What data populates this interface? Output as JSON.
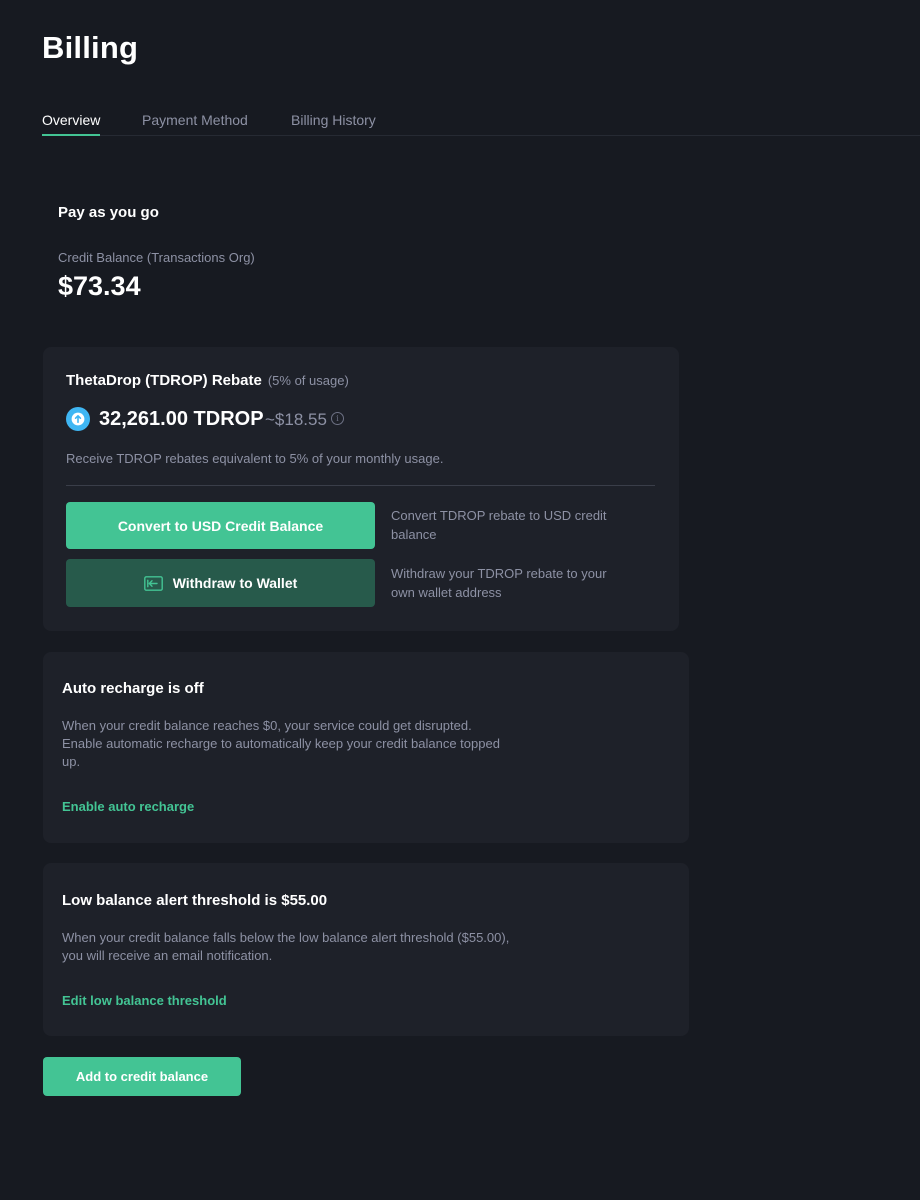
{
  "page": {
    "title": "Billing"
  },
  "tabs": [
    {
      "label": "Overview",
      "active": true
    },
    {
      "label": "Payment Method",
      "active": false
    },
    {
      "label": "Billing History",
      "active": false
    }
  ],
  "plan": {
    "title": "Pay as you go",
    "credit_label": "Credit Balance (Transactions Org)",
    "credit_amount": "$73.34"
  },
  "rebate": {
    "title": "ThetaDrop (TDROP) Rebate",
    "subtitle": "(5% of usage)",
    "amount": "32,261.00 TDROP",
    "usd_value": "~$18.55",
    "description": "Receive TDROP rebates equivalent to 5% of your monthly usage.",
    "convert_button": "Convert to USD Credit Balance",
    "convert_note": "Convert TDROP rebate to USD credit balance",
    "withdraw_button": "Withdraw to Wallet",
    "withdraw_note": "Withdraw your TDROP rebate to your own wallet address",
    "icons": {
      "token": "tdrop-token-icon",
      "info": "info-icon",
      "withdraw": "wallet-exit-icon"
    }
  },
  "auto_recharge": {
    "title": "Auto recharge is off",
    "description": "When your credit balance reaches $0, your service could get disrupted. Enable automatic recharge to automatically keep your credit balance topped up.",
    "link": "Enable auto recharge"
  },
  "low_balance": {
    "title": "Low balance alert threshold is $55.00",
    "description": "When your credit balance falls below the low balance alert threshold ($55.00), you will receive an email notification.",
    "link": "Edit low balance threshold"
  },
  "actions": {
    "add_credit_button": "Add to credit balance"
  },
  "colors": {
    "background": "#171a21",
    "card": "#1e2129",
    "accent": "#43c494",
    "accent_dark": "#275a4b",
    "muted_text": "#8d91a4",
    "token_blue": "#3fb6f3"
  }
}
